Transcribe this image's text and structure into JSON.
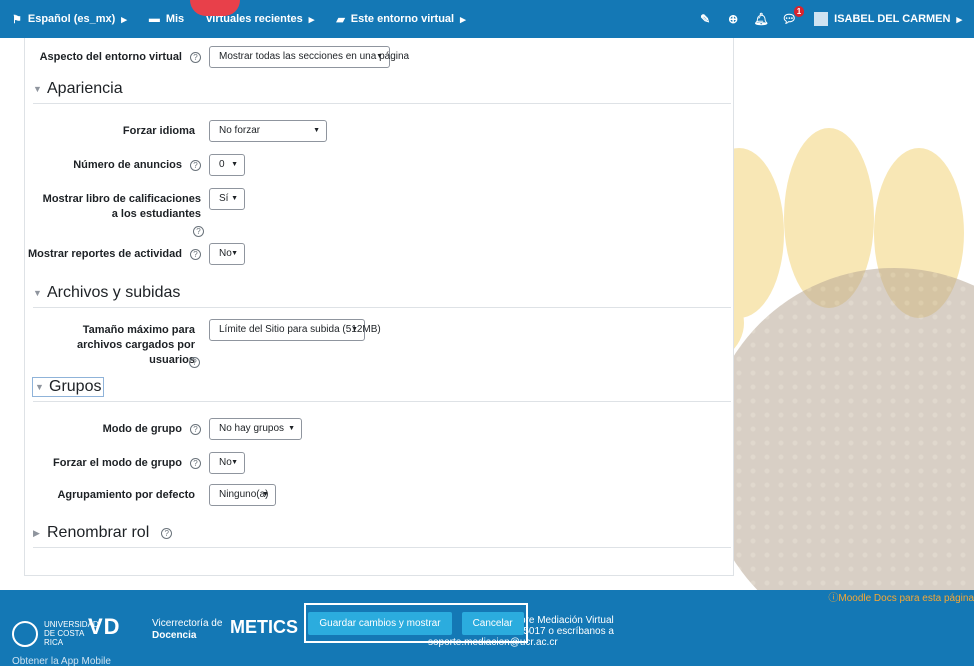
{
  "navbar": {
    "language": "Español (es_mx)",
    "my_courses": "Mis",
    "recent_courses": "virtuales recientes",
    "this_course": "Este entorno virtual",
    "notification_count": "1",
    "user_name": "ISABEL DEL CARMEN"
  },
  "form": {
    "course_format": {
      "label": "Aspecto del entorno virtual",
      "value": "Mostrar todas las secciones en una página"
    },
    "sections": {
      "appearance": "Apariencia",
      "files": "Archivos y subidas",
      "groups": "Grupos",
      "rename_role": "Renombrar rol"
    },
    "force_language": {
      "label": "Forzar idioma",
      "value": "No forzar"
    },
    "news_items": {
      "label": "Número de anuncios",
      "value": "0"
    },
    "show_grades": {
      "label": "Mostrar libro de calificaciones a los estudiantes",
      "value": "Sí"
    },
    "show_reports": {
      "label": "Mostrar reportes de actividad",
      "value": "No"
    },
    "max_bytes": {
      "label": "Tamaño máximo para archivos cargados por usuarios",
      "value": "Límite del Sitio para subida (512MB)"
    },
    "group_mode": {
      "label": "Modo de grupo",
      "value": "No hay grupos"
    },
    "force_group_mode": {
      "label": "Forzar el modo de grupo",
      "value": "No"
    },
    "default_grouping": {
      "label": "Agrupamiento por defecto",
      "value": "Ninguno(a)"
    }
  },
  "footer": {
    "moodle_docs": "Moodle Docs para esta página",
    "ucr_logo_text": "UNIVERSIDAD DE COSTA RICA",
    "vd": "VD",
    "vd_sub_1": "Vicerrectoría de",
    "vd_sub_2": "Docencia",
    "metics": "METICS",
    "support_line_1": "bre Mediación Virtual",
    "support_line_2": "-5017 o escríbanos a",
    "support_line_3": "soporte.mediacion@ucr.ac.cr",
    "app_link": "Obtener la App Mobile",
    "save_button": "Guardar cambios y mostrar",
    "cancel_button": "Cancelar"
  },
  "icons": {
    "help": "?",
    "flag": "flag-icon",
    "briefcase": "briefcase-icon",
    "book": "book-icon",
    "edit": "edit-icon",
    "plus": "plus-circle-icon",
    "bell": "bell-icon",
    "chat": "chat-icon"
  },
  "colors": {
    "navbar": "#1478b5",
    "button": "#2bacde",
    "docs_link": "#f7a833",
    "badge": "#d9232d"
  }
}
